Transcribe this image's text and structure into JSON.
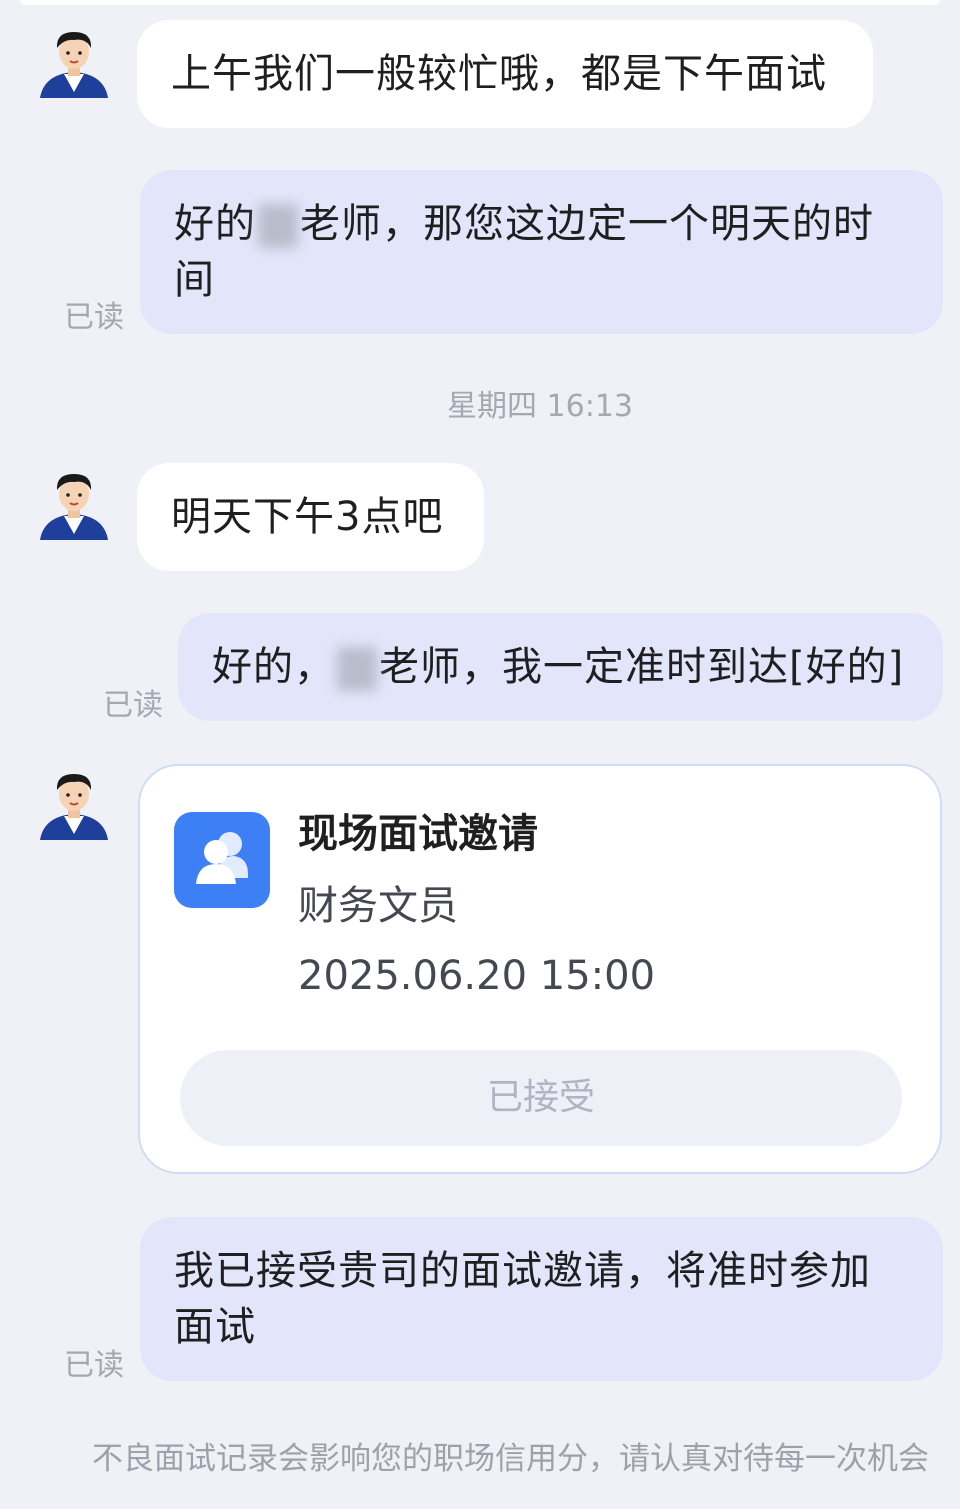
{
  "messages": [
    {
      "text": "上午我们一般较忙哦，都是下午面试"
    },
    {
      "before": "好的",
      "after": "老师，那您这边定一个明天的时间",
      "read": "已读"
    },
    {
      "text": "明天下午3点吧"
    },
    {
      "before": "好的，",
      "after": "老师，我一定准时到达[好的]",
      "read": "已读"
    },
    {
      "text": "我已接受贵司的面试邀请，将准时参加面试",
      "read": "已读"
    }
  ],
  "timestamp": "星期四 16:13",
  "invite_card": {
    "title": "现场面试邀请",
    "position": "财务文员",
    "datetime": "2025.06.20 15:00",
    "button_label": "已接受"
  },
  "footer_notice": "不良面试记录会影响您的职场信用分，请认真对待每一次机会",
  "colors": {
    "background": "#f0f1f6",
    "outgoing_bubble": "#e3e6fb",
    "incoming_bubble": "#ffffff",
    "card_icon": "#3d7ff5"
  }
}
